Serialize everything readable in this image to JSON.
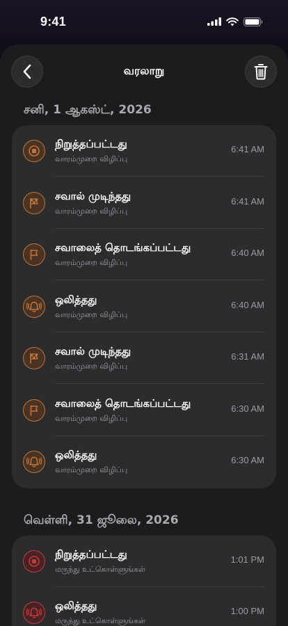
{
  "status_bar": {
    "time": "9:41"
  },
  "header": {
    "title": "வரலாறு",
    "back_icon": "chevron-left-icon",
    "delete_icon": "trash-icon"
  },
  "colors": {
    "accent_orange": "#c0753a",
    "accent_red": "#c23a3a",
    "card_bg": "#2c2c2e",
    "sheet_bg": "#1c1c1e"
  },
  "sections": [
    {
      "date": "சனி, 1 ஆகஸ்ட், 2026",
      "events": [
        {
          "title": "நிறுத்தப்பட்டது",
          "subtitle": "வாரம்முறை விழிப்பு",
          "time": "6:41 AM",
          "icon": "stop-icon",
          "tone": "orange"
        },
        {
          "title": "சவால் முடிந்தது",
          "subtitle": "வாரம்முறை விழிப்பு",
          "time": "6:41 AM",
          "icon": "checkered-flag-icon",
          "tone": "orange"
        },
        {
          "title": "சவாலைத் தொடங்கப்பட்டது",
          "subtitle": "வாரம்முறை விழிப்பு",
          "time": "6:40 AM",
          "icon": "flag-icon",
          "tone": "orange"
        },
        {
          "title": "ஒலித்தது",
          "subtitle": "வாரம்முறை விழிப்பு",
          "time": "6:40 AM",
          "icon": "ringing-bell-icon",
          "tone": "orange"
        },
        {
          "title": "சவால் முடிந்தது",
          "subtitle": "வாரம்முறை விழிப்பு",
          "time": "6:31 AM",
          "icon": "checkered-flag-icon",
          "tone": "orange"
        },
        {
          "title": "சவாலைத் தொடங்கப்பட்டது",
          "subtitle": "வாரம்முறை விழிப்பு",
          "time": "6:30 AM",
          "icon": "flag-icon",
          "tone": "orange"
        },
        {
          "title": "ஒலித்தது",
          "subtitle": "வாரம்முறை விழிப்பு",
          "time": "6:30 AM",
          "icon": "ringing-bell-icon",
          "tone": "orange"
        }
      ]
    },
    {
      "date": "வெள்ளி, 31 ஜூலை, 2026",
      "events": [
        {
          "title": "நிறுத்தப்பட்டது",
          "subtitle": "மருந்து உட்கொள்ளுங்கள்",
          "time": "1:01 PM",
          "icon": "stop-icon",
          "tone": "red"
        },
        {
          "title": "ஒலித்தது",
          "subtitle": "மருந்து உட்கொள்ளுங்கள்",
          "time": "1:00 PM",
          "icon": "ringing-bell-icon",
          "tone": "red"
        }
      ]
    }
  ]
}
